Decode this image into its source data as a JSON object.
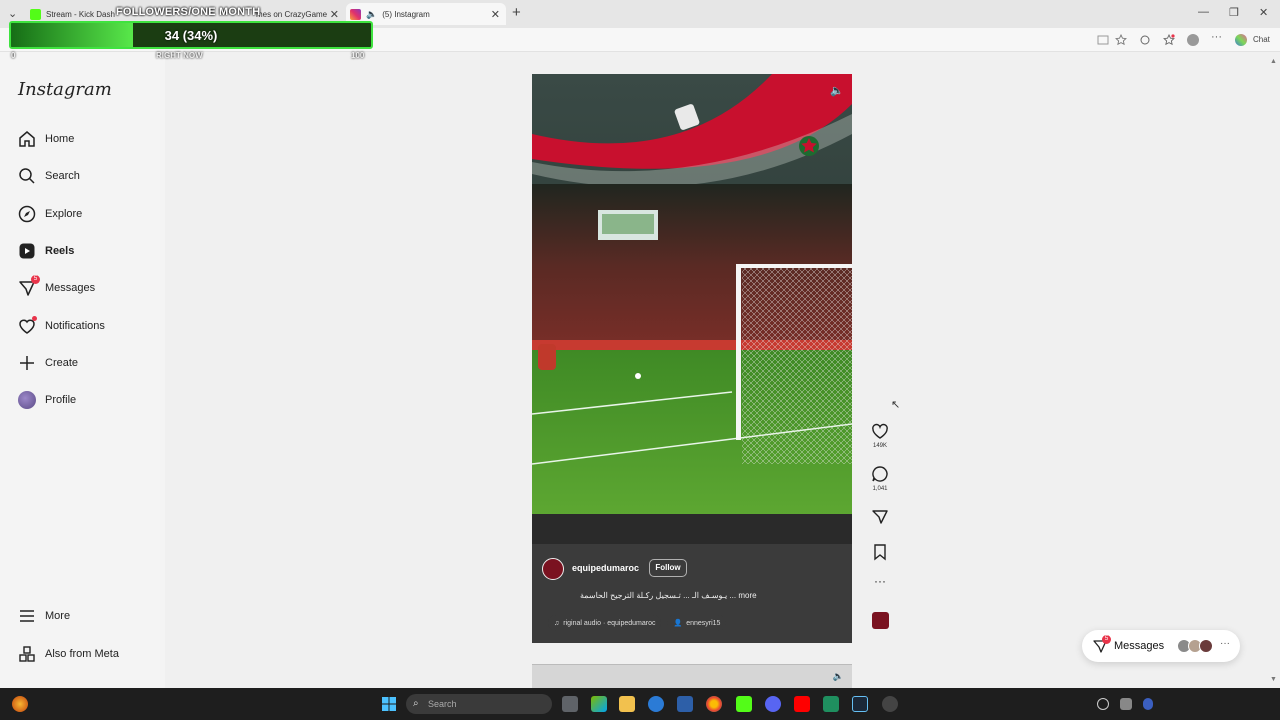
{
  "browser": {
    "tabs": [
      {
        "label": "Stream - Kick Dash"
      },
      {
        "label": "mes on CrazyGame"
      },
      {
        "label": "(5) Instagram"
      }
    ]
  },
  "overlay": {
    "title": "FOLLOWERS/ONE MONTH",
    "value_text": "34 (34%)",
    "progress_fraction": 0.34,
    "min_label": "0",
    "mid_label": "RIGHT NOW",
    "max_label": "100"
  },
  "sidebar": {
    "logo": "Instagram",
    "items": [
      {
        "label": "Home",
        "icon": "home-icon"
      },
      {
        "label": "Search",
        "icon": "search-icon"
      },
      {
        "label": "Explore",
        "icon": "compass-icon"
      },
      {
        "label": "Reels",
        "icon": "reels-icon"
      },
      {
        "label": "Messages",
        "icon": "messenger-icon",
        "badge": "5"
      },
      {
        "label": "Notifications",
        "icon": "heart-icon"
      },
      {
        "label": "Create",
        "icon": "plus-icon"
      },
      {
        "label": "Profile",
        "icon": "avatar"
      }
    ],
    "more": "More",
    "also_from_meta": "Also from Meta"
  },
  "reel": {
    "username": "equipedumaroc",
    "follow_label": "Follow",
    "caption": "يـوسـف الـ ... تـسجيل ركـلة الترجيح الحاسمة ... more",
    "audio": "riginal audio · equipedumaroc",
    "tagged_user": "ennesyri15"
  },
  "actions": {
    "likes": "149K",
    "comments": "1,041"
  },
  "messages_pill": {
    "label": "Messages",
    "badge": "5"
  },
  "taskbar": {
    "search_placeholder": "Search"
  },
  "colors": {
    "accent_green": "#3fe33f",
    "badge_red": "#e8344a",
    "pitch_green": "#4f9a2a"
  }
}
